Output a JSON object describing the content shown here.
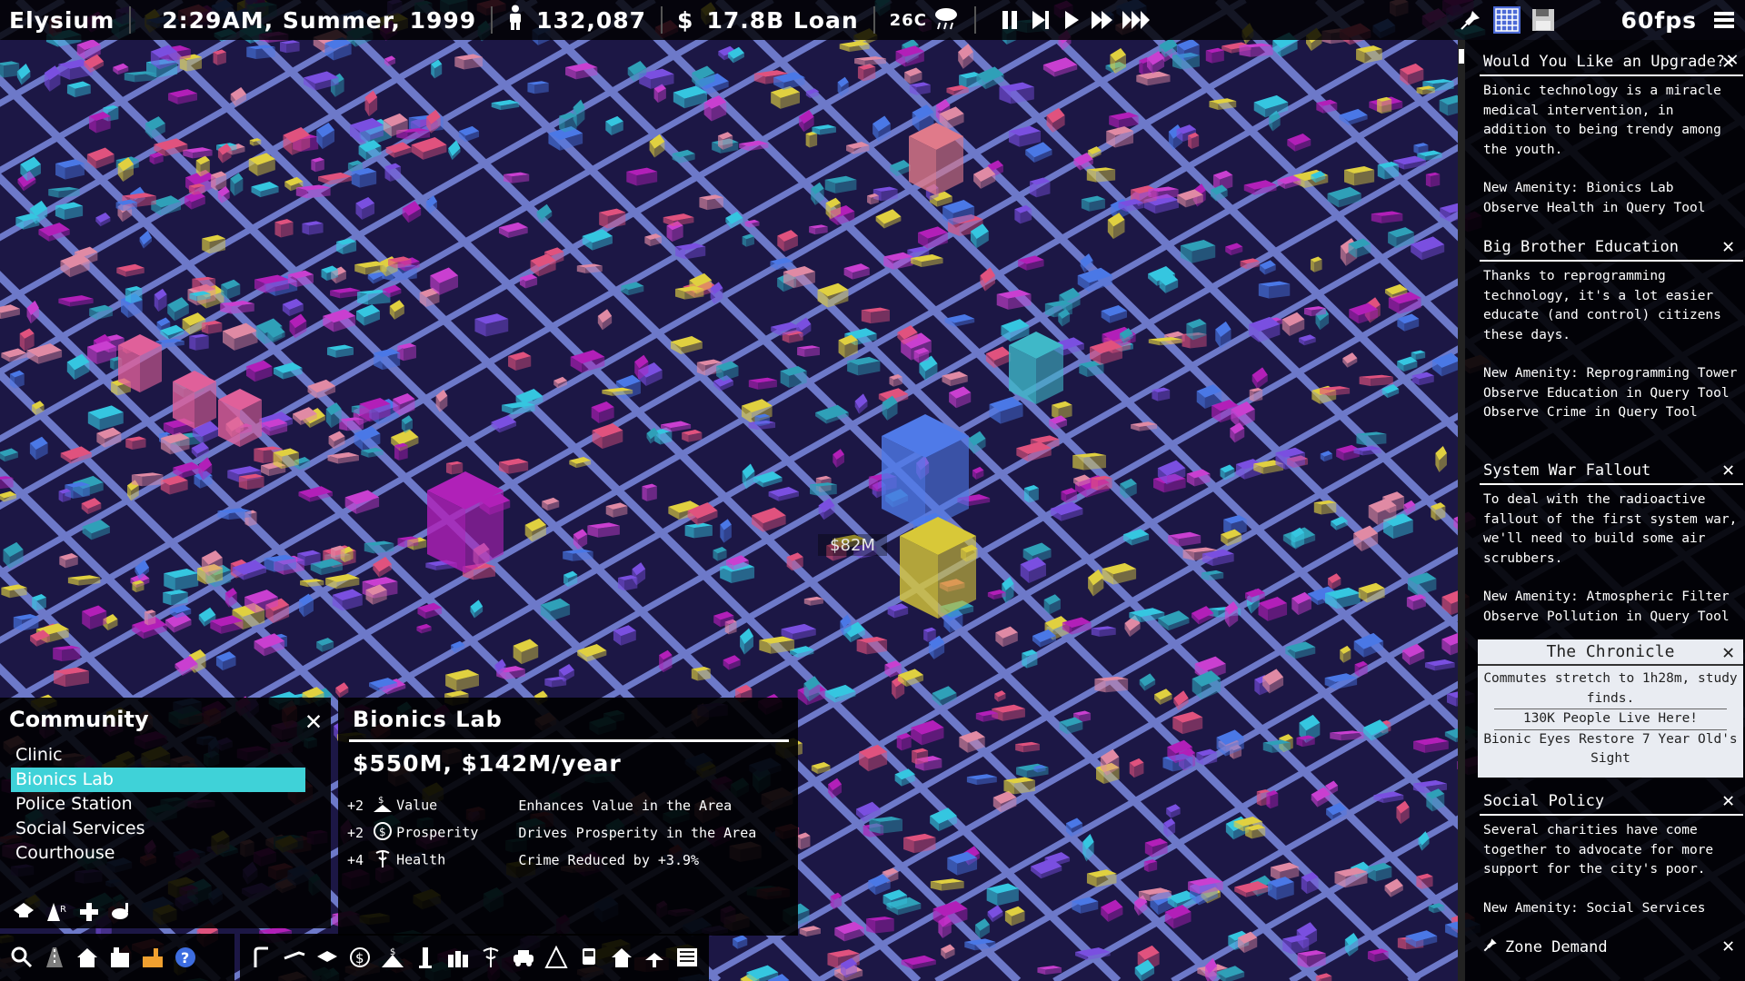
{
  "topbar": {
    "city_name": "Elysium",
    "datetime": "2:29AM, Summer, 1999",
    "population": "132,087",
    "money_label": "17.8B Loan",
    "temperature": "26C",
    "fps": "60fps"
  },
  "map_label": "$82M",
  "notifications": [
    {
      "title": "Would You Like an Upgrade?",
      "paragraphs": [
        "Bionic technology is a miracle medical intervention, in addition to being trendy among the youth.",
        "New Amenity: Bionics Lab\nObserve Health in Query Tool"
      ]
    },
    {
      "title": "Big Brother Education",
      "paragraphs": [
        "Thanks to reprogramming technology, it's a lot easier educate (and control) citizens these days.",
        "New Amenity: Reprogramming Tower\nObserve Education in Query Tool\nObserve Crime in Query Tool"
      ]
    },
    {
      "title": "System War Fallout",
      "paragraphs": [
        "To deal with the radioactive fallout of the first system war, we'll need to build some air scrubbers.",
        "New Amenity: Atmospheric Filter\nObserve Pollution in Query Tool"
      ]
    },
    {
      "title": "Social Policy",
      "paragraphs": [
        "Several charities have come together to advocate for more support for the city's poor.",
        "New Amenity: Social Services"
      ]
    }
  ],
  "chronicle": {
    "title": "The Chronicle",
    "headlines": [
      "Commutes stretch to 1h28m, study finds.",
      "130K People Live Here!",
      "Bionic Eyes Restore 7 Year Old's Sight"
    ]
  },
  "zone_demand": {
    "title": "Zone Demand"
  },
  "community": {
    "title": "Community",
    "items": [
      "Clinic",
      "Bionics Lab",
      "Police Station",
      "Social Services",
      "Courthouse"
    ],
    "selected": 1
  },
  "detail": {
    "title": "Bionics Lab",
    "cost": "$550M, $142M/year",
    "stats": [
      {
        "amount": "+2",
        "icon": "value-icon",
        "label": "Value",
        "effect": "Enhances Value in the Area"
      },
      {
        "amount": "+2",
        "icon": "prosperity-icon",
        "label": "Prosperity",
        "effect": "Drives Prosperity in the Area"
      },
      {
        "amount": "+4",
        "icon": "health-icon",
        "label": "Health",
        "effect": "Crime Reduced by +3.9%"
      }
    ]
  },
  "colors": {
    "accent": "#3fd2d8",
    "building_magenta": "#b21fb8",
    "building_cyan": "#35c6e0",
    "road": "#6d79c9",
    "ground": "#1a1540"
  }
}
